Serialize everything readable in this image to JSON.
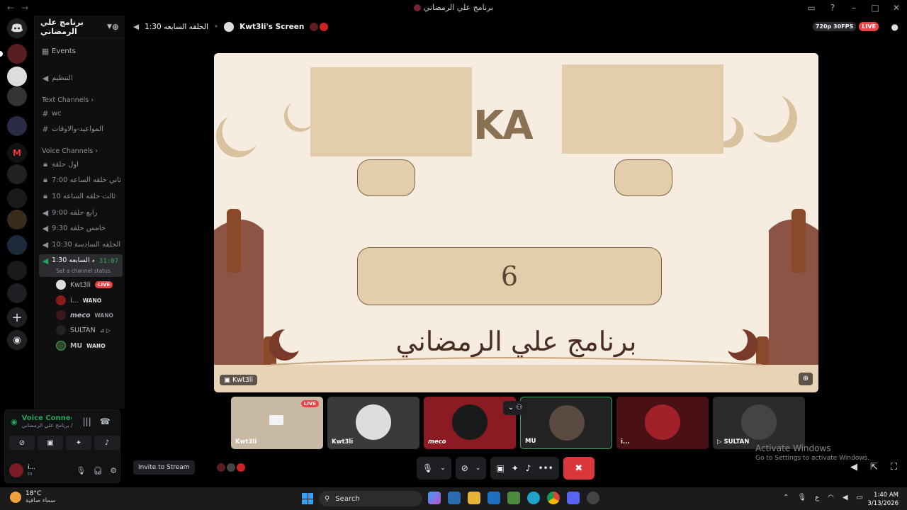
{
  "window": {
    "title": "برنامج علي الرمضاني",
    "controls": [
      "minimize",
      "maximize",
      "close"
    ]
  },
  "server": {
    "name": "برنامج علي الرمضاني",
    "events_label": "Events",
    "channels": [
      {
        "icon": "speaker-icon",
        "label": "التنظيم"
      },
      {
        "category": "Text Channels"
      },
      {
        "icon": "hash-icon",
        "label": "wc"
      },
      {
        "icon": "hash-icon",
        "label": "المواعيد-والاوقات"
      },
      {
        "category": "Voice Channels"
      },
      {
        "icon": "lock-icon",
        "label": "اول حلقة"
      },
      {
        "icon": "lock-icon",
        "label": "ثاني حلقه الساعه 7:00"
      },
      {
        "icon": "lock-icon",
        "label": "ثالث حلقه الساعه 10"
      },
      {
        "icon": "speaker-icon",
        "label": "رابع حلقه 9:00"
      },
      {
        "icon": "speaker-icon",
        "label": "خامس حلقه 9:30"
      },
      {
        "icon": "speaker-icon",
        "label": "الحلقه السادسة 10:30"
      }
    ],
    "active_channel": {
      "label": "الحلقه السابعه 1:30",
      "timer": "31:07",
      "status_placeholder": "Set a channel status"
    },
    "members": [
      {
        "name": "Kwt3li",
        "badge": "LIVE"
      },
      {
        "name": "i...",
        "badge": "WANO"
      },
      {
        "name": "meco",
        "badge": "WANO"
      },
      {
        "name": "SULTAN",
        "badge": ""
      },
      {
        "name": "MU",
        "badge": "WANO"
      }
    ]
  },
  "voice_panel": {
    "title": "Voice Connected",
    "subtitle": "الحلقه السابعه / برنامج علي الرمضاني",
    "user_name": "i...",
    "user_status": "In"
  },
  "stream_header": {
    "channel": "الحلقه السابعه 1:30",
    "screen_label": "Kwt3li's Screen",
    "quality": "720p 30FPS",
    "live": "LIVE"
  },
  "stream": {
    "logo": "KA",
    "number": "6",
    "title": "برنامج علي الرمضاني",
    "name_tag": "Kwt3li"
  },
  "thumbnails": [
    {
      "label": "Kwt3li",
      "live": "LIVE"
    },
    {
      "label": "Kwt3li",
      "live": ""
    },
    {
      "label": "meco",
      "live": ""
    },
    {
      "label": "MU",
      "live": ""
    },
    {
      "label": "i...",
      "live": ""
    },
    {
      "label": "SULTAN",
      "live": ""
    }
  ],
  "watermark": {
    "line1": "Activate Windows",
    "line2": "Go to Settings to activate Windows."
  },
  "bottom": {
    "invite_label": "Invite to Stream"
  },
  "taskbar": {
    "temperature": "18°C",
    "weather_text": "سماء صافية",
    "search_label": "Search",
    "time": "1:40 AM",
    "date": "3/13/2026",
    "lang": "ع"
  },
  "colors": {
    "accent_green": "#23a559",
    "live_red": "#ed4245",
    "hangup_red": "#da373c",
    "stream_bg": "#f6ece0"
  }
}
